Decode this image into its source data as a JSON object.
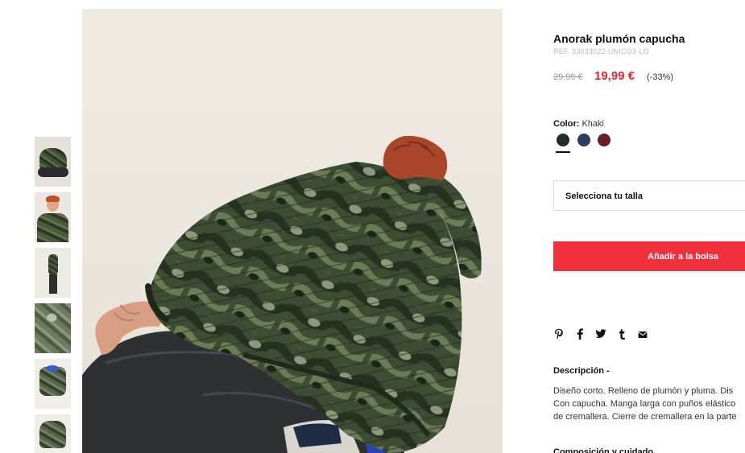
{
  "product": {
    "title": "Anorak plumón capucha",
    "ref": "REF. 33033022-UNICO3-LO",
    "old_price": "29,99 €",
    "new_price": "19,99 €",
    "discount": "(-33%)"
  },
  "color": {
    "label": "Color:",
    "value": "Khaki",
    "swatches": [
      {
        "name": "Khaki",
        "hex": "#1f3124",
        "selected": true
      },
      {
        "name": "Navy",
        "hex": "#2e3f5e",
        "selected": false
      },
      {
        "name": "Burgundy",
        "hex": "#6a1f2a",
        "selected": false
      }
    ]
  },
  "size": {
    "placeholder": "Selecciona tu talla"
  },
  "cart": {
    "add_label": "Añadir a la bolsa"
  },
  "share": {
    "icons": [
      "pinterest-icon",
      "facebook-icon",
      "twitter-icon",
      "tumblr-icon",
      "mail-icon"
    ],
    "glyphs": [
      "℗",
      "f",
      "t",
      "t",
      "✉"
    ]
  },
  "description": {
    "heading": "Descripción -",
    "lines": [
      "Diseño corto. Relleno de plumón y pluma. Dis",
      "Con capucha. Manga larga con puños elástico",
      "de cremallera. Cierre de cremallera en la parte"
    ]
  },
  "composition": {
    "heading": "Composición y cuidado"
  },
  "colors": {
    "accent": "#f0303c",
    "price_red": "#e8232f"
  }
}
